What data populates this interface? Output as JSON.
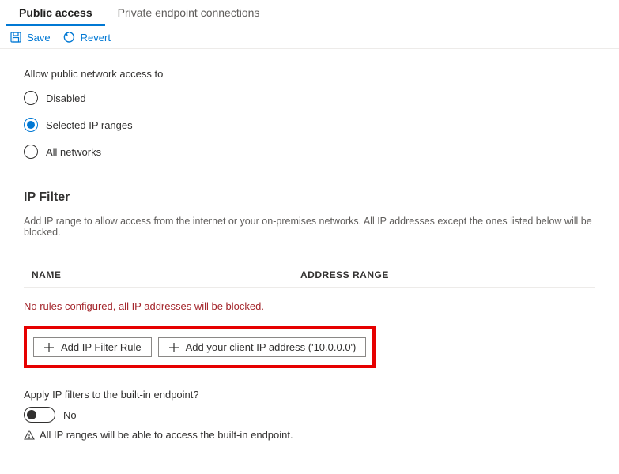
{
  "tabs": {
    "public_access": "Public access",
    "private_endpoint": "Private endpoint connections"
  },
  "toolbar": {
    "save": "Save",
    "revert": "Revert"
  },
  "access": {
    "label": "Allow public network access to",
    "options": {
      "disabled": "Disabled",
      "selected_ip": "Selected IP ranges",
      "all_networks": "All networks"
    }
  },
  "ipfilter": {
    "heading": "IP Filter",
    "description": "Add IP range to allow access from the internet or your on-premises networks. All IP addresses except the ones listed below will be blocked.",
    "columns": {
      "name": "NAME",
      "address_range": "ADDRESS RANGE"
    },
    "empty_warning": "No rules configured, all IP addresses will be blocked.",
    "add_rule": "Add IP Filter Rule",
    "add_client_ip": "Add your client IP address ('10.0.0.0')"
  },
  "apply": {
    "label": "Apply IP filters to the built-in endpoint?",
    "value": "No",
    "info": "All IP ranges will be able to access the built-in endpoint."
  }
}
